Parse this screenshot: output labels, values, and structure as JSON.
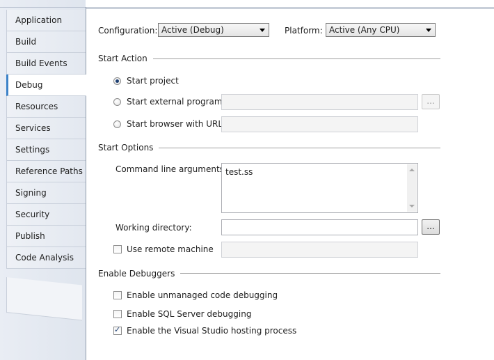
{
  "tabs": [
    {
      "label": "Application"
    },
    {
      "label": "Build"
    },
    {
      "label": "Build Events"
    },
    {
      "label": "Debug"
    },
    {
      "label": "Resources"
    },
    {
      "label": "Services"
    },
    {
      "label": "Settings"
    },
    {
      "label": "Reference Paths"
    },
    {
      "label": "Signing"
    },
    {
      "label": "Security"
    },
    {
      "label": "Publish"
    },
    {
      "label": "Code Analysis"
    }
  ],
  "active_tab": "Debug",
  "header": {
    "configuration_label": "Configuration:",
    "configuration_value": "Active (Debug)",
    "platform_label": "Platform:",
    "platform_value": "Active (Any CPU)"
  },
  "start_action": {
    "title": "Start Action",
    "start_project": "Start project",
    "start_external": "Start external program:",
    "start_browser": "Start browser with URL:",
    "browse_label": "...",
    "selected": "Start project"
  },
  "start_options": {
    "title": "Start Options",
    "cmd_args_label": "Command line arguments:",
    "cmd_args_value": "test.ss",
    "working_dir_label": "Working directory:",
    "working_dir_value": "",
    "browse_label": "...",
    "remote_machine_label": "Use remote machine",
    "remote_machine_checked": false
  },
  "debuggers": {
    "title": "Enable Debuggers",
    "unmanaged": "Enable unmanaged code debugging",
    "unmanaged_checked": false,
    "sql": "Enable SQL Server debugging",
    "sql_checked": false,
    "hosting": "Enable the Visual Studio hosting process",
    "hosting_checked": true
  },
  "check_glyph": "✓"
}
